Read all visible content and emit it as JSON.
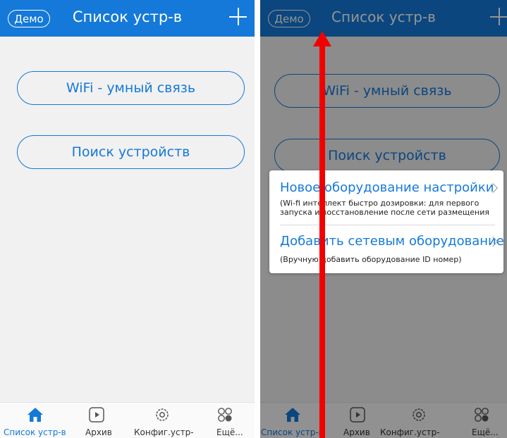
{
  "header": {
    "demo_label": "Демо",
    "title": "Список устр-в",
    "add_icon": "plus-icon",
    "color": "#1479d9"
  },
  "main": {
    "wifi_button": "WiFi - умный связь",
    "search_button": "Поиск устройств"
  },
  "tabs": [
    {
      "label": "Список устр-в",
      "icon": "home-icon",
      "active": true
    },
    {
      "label": "Архив",
      "icon": "play-icon",
      "active": false
    },
    {
      "label": "Конфиг.устр-",
      "icon": "gear-icon",
      "active": false
    },
    {
      "label": "Ещё...",
      "icon": "more-icon",
      "active": false
    }
  ],
  "popup": {
    "option1": {
      "title": "Новое оборудование настройки",
      "line1": "(Wi-fi интеллект быстро дозировки: для первого",
      "line2": "запуска и восстановление после сети размещения"
    },
    "option2": {
      "title": "Добавить сетевым оборудование",
      "line1": "(Вручную добавить оборудование ID номер)"
    }
  },
  "annotation": {
    "color": "#ff0000",
    "direction": "up"
  }
}
